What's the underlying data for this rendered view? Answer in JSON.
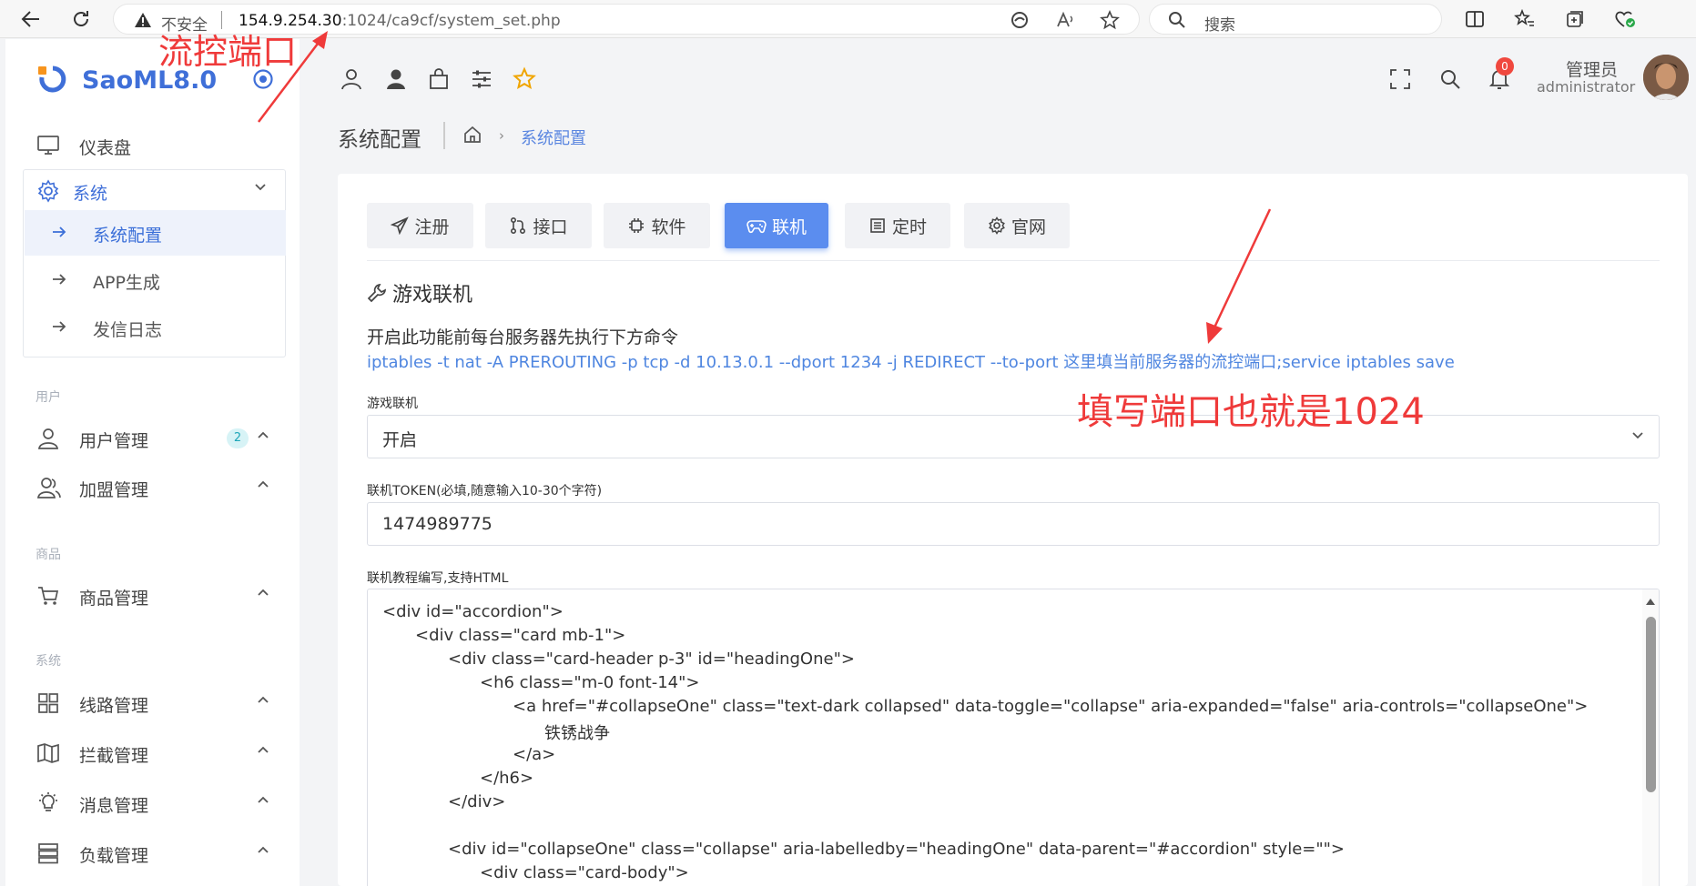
{
  "browser": {
    "insecure_label": "不安全",
    "url_host": "154.9.254.30",
    "url_rest": ":1024/ca9cf/system_set.php",
    "search_placeholder": "搜索"
  },
  "brand": {
    "name": "SaoML8.0",
    "accent": "#3f6fd8"
  },
  "sidebar": {
    "dashboard": "仪表盘",
    "system": "系统",
    "system_children": [
      "系统配置",
      "APP生成",
      "发信日志"
    ],
    "section_user": "用户",
    "user_mgmt": "用户管理",
    "user_badge": "2",
    "franchise_mgmt": "加盟管理",
    "section_goods": "商品",
    "goods_mgmt": "商品管理",
    "section_system": "系统",
    "route_mgmt": "线路管理",
    "intercept_mgmt": "拦截管理",
    "message_mgmt": "消息管理",
    "load_mgmt": "负载管理"
  },
  "header": {
    "notification_count": "0",
    "user_name": "管理员",
    "user_role": "administrator"
  },
  "breadcrumb": {
    "title": "系统配置",
    "current": "系统配置"
  },
  "tabs": [
    "注册",
    "接口",
    "软件",
    "联机",
    "定时",
    "官网"
  ],
  "active_tab": "联机",
  "section": {
    "heading": "游戏联机",
    "hint": "开启此功能前每台服务器先执行下方命令",
    "command": "iptables -t nat -A PREROUTING -p tcp -d 10.13.0.1 --dport 1234 -j REDIRECT --to-port 这里填当前服务器的流控端口;service iptables save"
  },
  "form": {
    "game_label": "游戏联机",
    "game_value": "开启",
    "token_label": "联机TOKEN(必填,随意输入10-30个字符)",
    "token_value": "1474989775",
    "tutorial_label": "联机教程编写,支持HTML",
    "tutorial_lines": [
      "<div id=\"accordion\">",
      "<div class=\"card mb-1\">",
      "<div class=\"card-header p-3\" id=\"headingOne\">",
      "<h6 class=\"m-0 font-14\">",
      "<a href=\"#collapseOne\" class=\"text-dark collapsed\" data-toggle=\"collapse\" aria-expanded=\"false\" aria-controls=\"collapseOne\">",
      "铁锈战争",
      "</a>",
      "</h6>",
      "</div>",
      "",
      "<div id=\"collapseOne\" class=\"collapse\" aria-labelledby=\"headingOne\" data-parent=\"#accordion\" style=\"\">",
      "<div class=\"card-body\">"
    ]
  },
  "annotations": {
    "port_note": "流控端口",
    "fill_note": "填写端口也就是1024",
    "color": "#ef3a3a"
  }
}
